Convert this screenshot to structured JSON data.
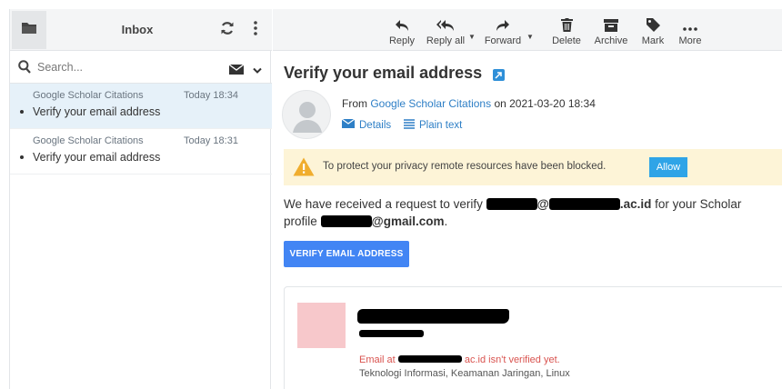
{
  "folder_list": {
    "title": "Inbox"
  },
  "search": {
    "placeholder": "Search..."
  },
  "messages": [
    {
      "from": "Google Scholar Citations",
      "date": "Today 18:34",
      "subject": "Verify your email address"
    },
    {
      "from": "Google Scholar Citations",
      "date": "Today 18:31",
      "subject": "Verify your email address"
    }
  ],
  "toolbar": {
    "reply": "Reply",
    "reply_all": "Reply all",
    "forward": "Forward",
    "delete": "Delete",
    "archive": "Archive",
    "mark": "Mark",
    "more": "More"
  },
  "message": {
    "subject": "Verify your email address",
    "from_prefix": "From",
    "from_name": "Google Scholar Citations",
    "on_text": "on 2021-03-20 18:34",
    "details": "Details",
    "plain_text": "Plain text",
    "privacy_notice": "To protect your privacy remote resources have been blocked.",
    "allow": "Allow",
    "body_part1": "We have received a request to verify",
    "body_at1": "@",
    "body_domain": ".ac.id",
    "body_part2": "for your Scholar",
    "body_part3": "profile",
    "body_gmail": "@gmail.com",
    "body_period": ".",
    "verify_button": "VERIFY EMAIL ADDRESS",
    "card": {
      "unverified_prefix": "Email at",
      "unverified_suffix": "ac.id isn't verified yet.",
      "interests": "Teknologi Informasi, Keamanan Jaringan, Linux"
    }
  },
  "colors": {
    "accent": "#2e7fc6",
    "primary_button": "#4285f4",
    "allow_button": "#2fa4e7",
    "notice_bg": "#fdf4d7",
    "selected_row": "#e6f1f9",
    "warning_text": "#d9534f"
  },
  "icons": {
    "folder": "folder-icon",
    "refresh": "refresh-icon",
    "menu": "vertical-dots-icon",
    "search": "search-icon",
    "envelope": "envelope-icon",
    "reply": "reply-icon",
    "reply_all": "reply-all-icon",
    "forward": "forward-icon",
    "delete": "trash-icon",
    "archive": "archive-icon",
    "mark": "tag-icon",
    "more": "more-dots-icon",
    "warning": "warning-icon"
  }
}
